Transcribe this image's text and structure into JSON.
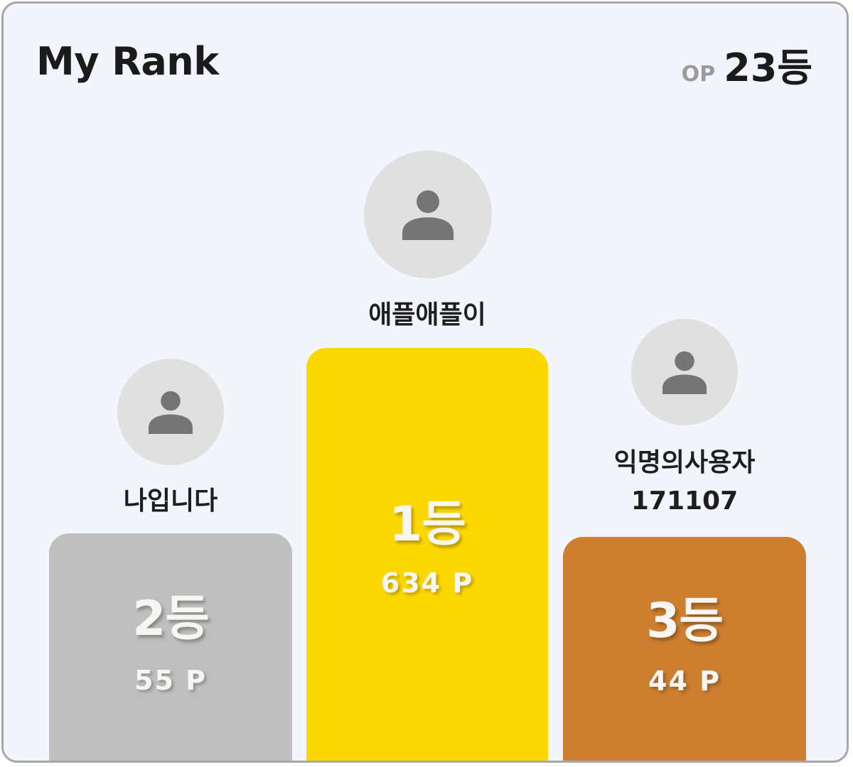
{
  "header": {
    "title": "My Rank",
    "op_label": "OP",
    "my_rank": "23등"
  },
  "podium": [
    {
      "name": "애플애플이",
      "rank": "1등",
      "points": "634 P",
      "color": "#fdd700",
      "avatar_icon": "person-icon"
    },
    {
      "name": "나입니다",
      "rank": "2등",
      "points": "55 P",
      "color": "#bfbfbf",
      "avatar_icon": "person-icon"
    },
    {
      "name_lines": [
        "익명의사용자",
        "171107"
      ],
      "rank": "3등",
      "points": "44 P",
      "color": "#cd7e2f",
      "avatar_icon": "person-icon"
    }
  ]
}
